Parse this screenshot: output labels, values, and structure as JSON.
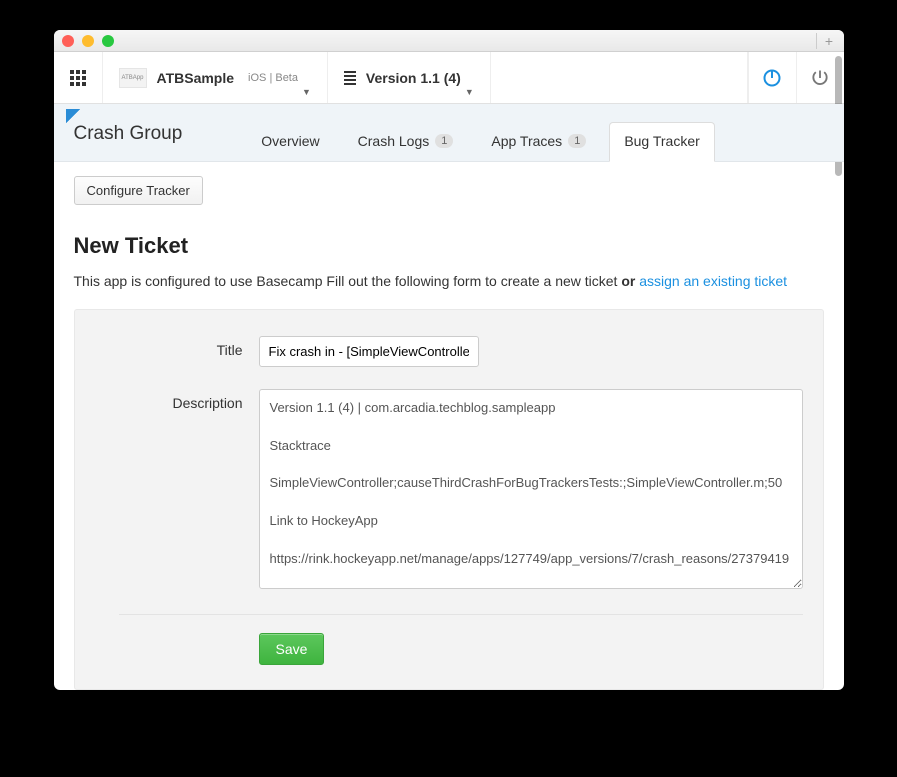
{
  "titlebar": {},
  "toolbar": {
    "app_logo_text": "ATBApp",
    "app_name": "ATBSample",
    "app_tags": "iOS | Beta",
    "version_label": "Version 1.1 (4)"
  },
  "subnav": {
    "group_title": "Crash Group",
    "tabs": [
      {
        "label": "Overview",
        "badge": null
      },
      {
        "label": "Crash Logs",
        "badge": "1"
      },
      {
        "label": "App Traces",
        "badge": "1"
      },
      {
        "label": "Bug Tracker",
        "badge": null
      }
    ]
  },
  "page": {
    "configure_button": "Configure Tracker",
    "heading": "New Ticket",
    "helptext_prefix": "This app is configured to use Basecamp Fill out the following form to create a new ticket ",
    "helptext_or": "or",
    "helptext_link": "assign an existing ticket"
  },
  "form": {
    "title_label": "Title",
    "title_value": "Fix crash in - [SimpleViewController",
    "description_label": "Description",
    "description_value": "Version 1.1 (4) | com.arcadia.techblog.sampleapp\n\nStacktrace\n\nSimpleViewController;causeThirdCrashForBugTrackersTests:;SimpleViewController.m;50\n\nLink to HockeyApp\n\nhttps://rink.hockeyapp.net/manage/apps/127749/app_versions/7/crash_reasons/27379419",
    "save_label": "Save"
  }
}
